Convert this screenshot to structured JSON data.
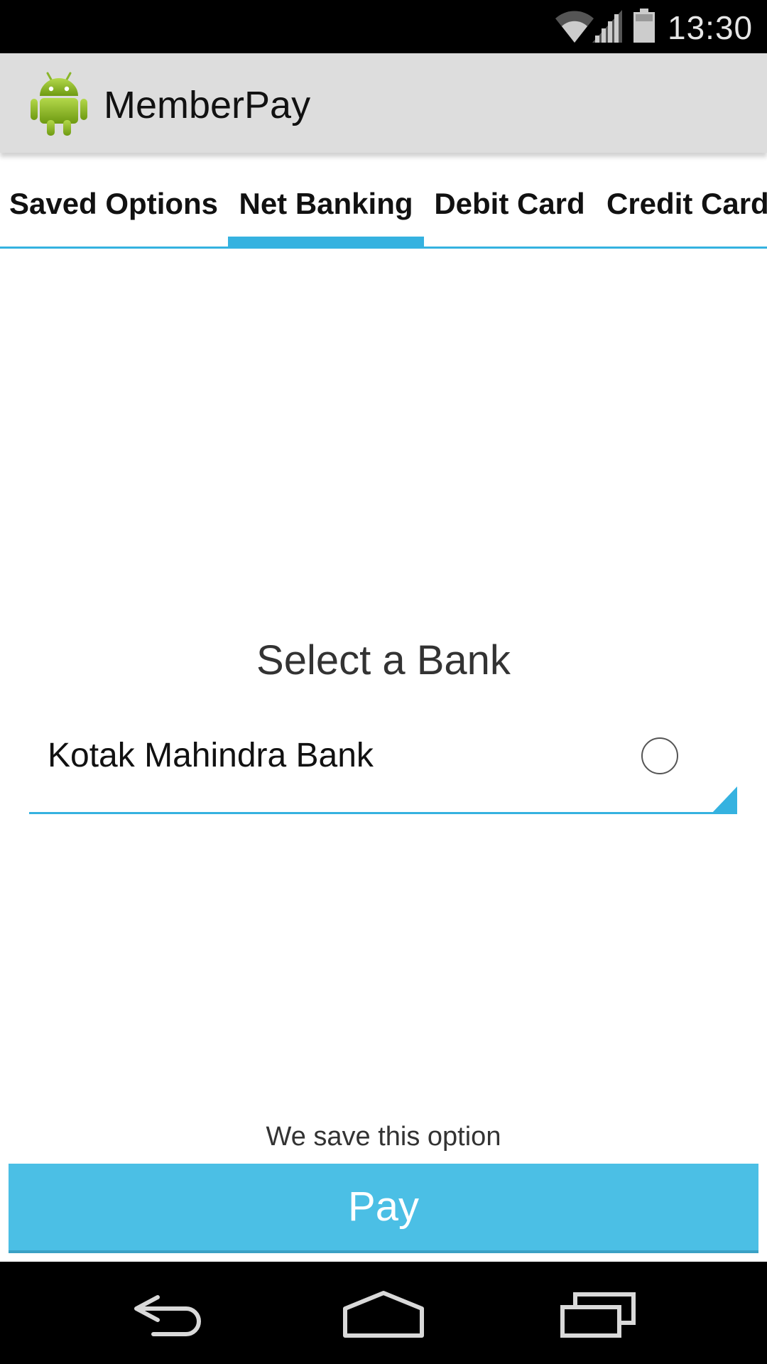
{
  "status_bar": {
    "time": "13:30",
    "icons": [
      "wifi-icon",
      "signal-icon",
      "battery-icon"
    ]
  },
  "action_bar": {
    "title": "MemberPay",
    "icon": "android-icon"
  },
  "tabs": [
    {
      "label": "Saved Options",
      "selected": false
    },
    {
      "label": "Net Banking",
      "selected": true
    },
    {
      "label": "Debit Card",
      "selected": false
    },
    {
      "label": "Credit Card",
      "selected": false
    }
  ],
  "content": {
    "title": "Select a Bank",
    "bank_spinner": {
      "selected_value": "Kotak Mahindra Bank",
      "radio_checked": false
    },
    "save_note": "We save this option",
    "pay_label": "Pay"
  },
  "nav_bar": {
    "icons": [
      "back-icon",
      "home-icon",
      "recents-icon"
    ]
  },
  "colors": {
    "accent": "#35b2e0",
    "pay_button": "#4bbfe5",
    "action_bar": "#dddddd",
    "system_bars": "#000000"
  }
}
